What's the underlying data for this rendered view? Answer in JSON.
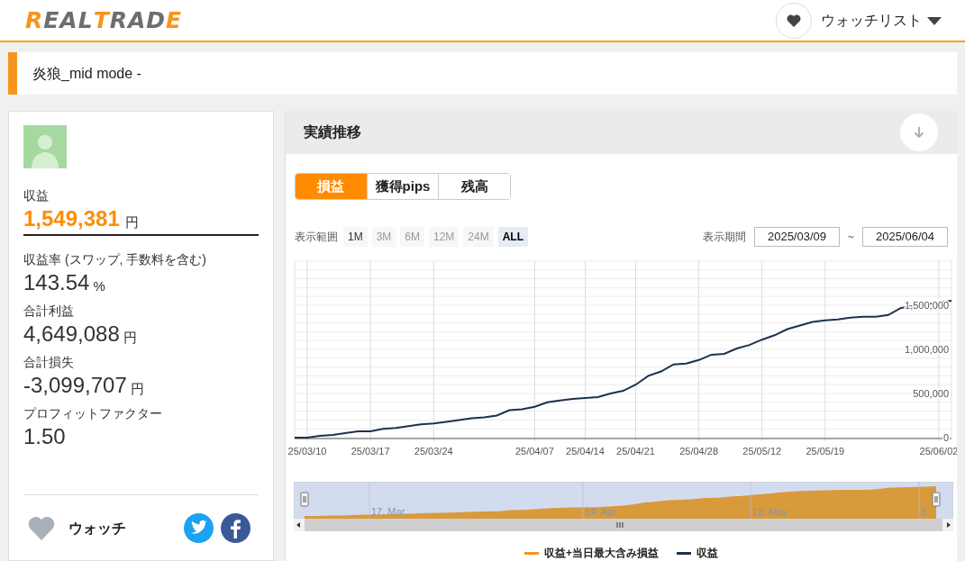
{
  "header": {
    "logo": [
      {
        "text": "R",
        "color": "#f7941d"
      },
      {
        "text": "EAL",
        "color": "#6d6e70"
      },
      {
        "text": "T",
        "color": "#f7941d"
      },
      {
        "text": "RAD",
        "color": "#6d6e70"
      },
      {
        "text": "E",
        "color": "#f7941d"
      }
    ],
    "watchlist": "ウォッチリスト"
  },
  "page_title": "炎狼_mid mode -",
  "profile": {
    "stats": [
      {
        "kind": "highlight",
        "label": "収益",
        "value": "1,549,381",
        "unit": "円"
      },
      {
        "kind": "normal",
        "label": "収益率 (スワップ, 手数料を含む)",
        "value": "143.54",
        "unit": "%"
      },
      {
        "kind": "normal",
        "label": "合計利益",
        "value": "4,649,088",
        "unit": "円"
      },
      {
        "kind": "normal",
        "label": "合計損失",
        "value": "-3,099,707",
        "unit": "円"
      },
      {
        "kind": "normal",
        "label": "プロフィットファクター",
        "value": "1.50"
      }
    ],
    "watch": "ウォッチ"
  },
  "panel": {
    "title": "実績推移",
    "tabs": [
      {
        "label": "損益",
        "selected": true
      },
      {
        "label": "獲得pips",
        "selected": false
      },
      {
        "label": "残高",
        "selected": false
      }
    ],
    "range_label": "表示範囲",
    "ranges": [
      {
        "label": "1M",
        "disabled": false,
        "selected": false
      },
      {
        "label": "3M",
        "disabled": true,
        "selected": false
      },
      {
        "label": "6M",
        "disabled": true,
        "selected": false
      },
      {
        "label": "12M",
        "disabled": true,
        "selected": false
      },
      {
        "label": "24M",
        "disabled": true,
        "selected": false
      },
      {
        "label": "ALL",
        "disabled": false,
        "selected": true
      }
    ],
    "period_label": "表示期間",
    "date_from": "2025/03/09",
    "date_sep": "~",
    "date_to": "2025/06/04",
    "chart_data": {
      "type": "line",
      "categories": [
        null,
        "25/03/10",
        null,
        null,
        null,
        null,
        "25/03/17",
        null,
        null,
        null,
        null,
        "25/03/24",
        null,
        null,
        null,
        null,
        null,
        null,
        null,
        "25/04/07",
        null,
        null,
        null,
        "25/04/14",
        null,
        null,
        null,
        "25/04/21",
        null,
        null,
        null,
        null,
        "25/04/28",
        null,
        null,
        null,
        null,
        "25/05/12",
        null,
        null,
        null,
        null,
        "25/05/19",
        null,
        null,
        null,
        null,
        null,
        null,
        null,
        null,
        "25/06/02",
        null
      ],
      "ylim": [
        0,
        2000000
      ],
      "grid": true,
      "yticks": [
        {
          "value": 0,
          "label": "0"
        },
        {
          "value": 500000,
          "label": "500,000"
        },
        {
          "value": 1000000,
          "label": "1,000,000"
        },
        {
          "value": 1500000,
          "label": "1,500,000"
        }
      ],
      "series": [
        {
          "name": "収益",
          "color": "#1c3150",
          "values": [
            0,
            0,
            20000,
            30000,
            50000,
            70000,
            70000,
            100000,
            110000,
            130000,
            150000,
            160000,
            180000,
            200000,
            220000,
            230000,
            250000,
            310000,
            320000,
            350000,
            400000,
            420000,
            440000,
            450000,
            460000,
            500000,
            530000,
            600000,
            700000,
            750000,
            830000,
            840000,
            880000,
            940000,
            950000,
            1010000,
            1050000,
            1110000,
            1160000,
            1230000,
            1270000,
            1310000,
            1330000,
            1340000,
            1360000,
            1370000,
            1370000,
            1390000,
            1470000,
            1490000,
            1510000,
            1530000,
            1550000
          ]
        }
      ]
    },
    "navigator_labels": [
      "17. Mar",
      "14. Apr",
      "12. May",
      "2."
    ],
    "legend": [
      {
        "label": "収益+当日最大含み損益",
        "color": "#f7941d"
      }
    ]
  }
}
